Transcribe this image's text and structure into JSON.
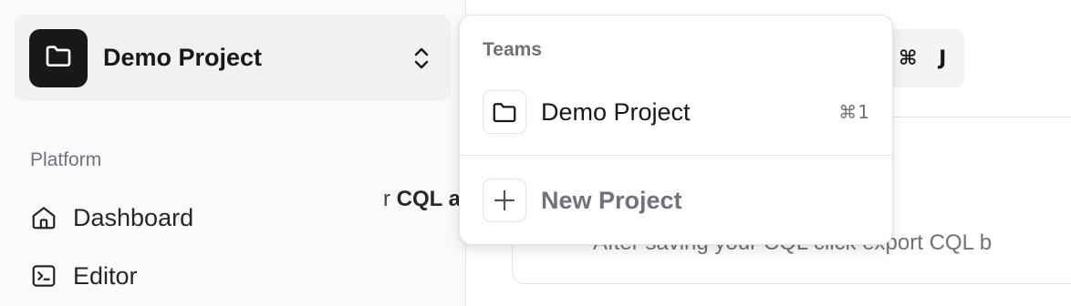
{
  "sidebar": {
    "project_switcher": {
      "name": "Demo Project",
      "logo_icon": "folder-icon",
      "toggle_icon": "chevrons-up-down-icon"
    },
    "group_label": "Platform",
    "items": [
      {
        "label": "Dashboard",
        "icon": "home-icon"
      },
      {
        "label": "Editor",
        "icon": "terminal-icon"
      }
    ]
  },
  "main": {
    "shortcut_chip": "⌘ J",
    "card": {
      "heading_pre": "r ",
      "heading_bold": "CQL as a FHII",
      "subtext": "After saving your CQL click export CQL b"
    }
  },
  "dropdown": {
    "label": "Teams",
    "items": [
      {
        "label": "Demo Project",
        "icon": "folder-icon",
        "shortcut": "⌘1"
      }
    ],
    "new_item": {
      "label": "New Project",
      "icon": "plus-icon"
    }
  },
  "colors": {
    "logo_bg": "#18181b",
    "sidebar_bg": "#fafafa",
    "switcher_bg": "#f1f1f2",
    "muted_text": "#71717a",
    "border": "#e4e4e7"
  }
}
